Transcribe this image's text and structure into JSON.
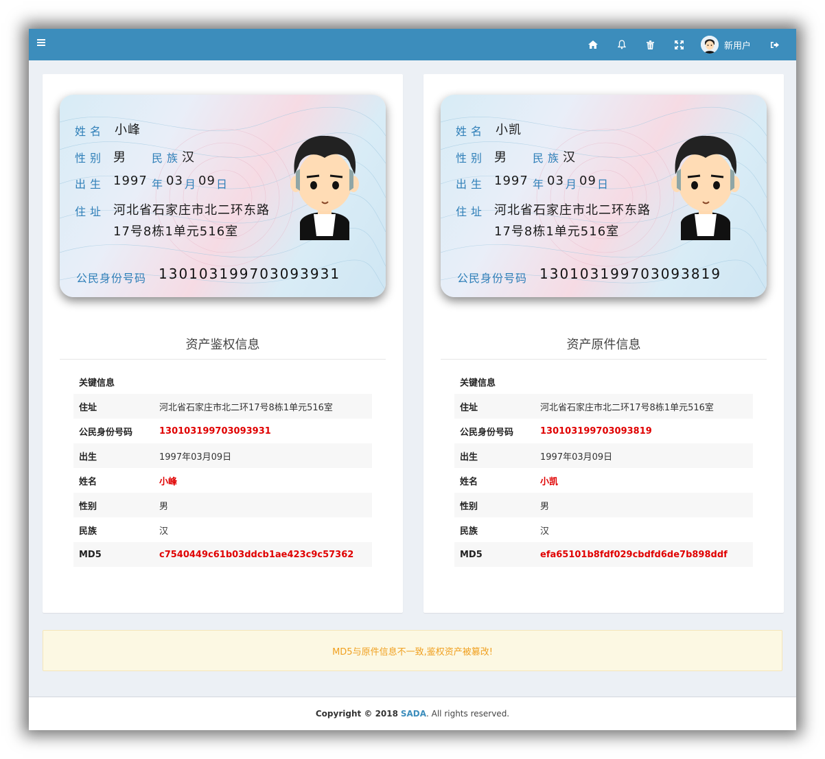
{
  "topbar": {
    "user_name": "新用户",
    "icons": [
      "menu-icon",
      "home-icon",
      "bell-icon",
      "trash-icon",
      "fullscreen-icon",
      "logout-icon"
    ]
  },
  "left": {
    "card": {
      "label_name": "姓名",
      "label_gender": "性别",
      "label_ethnic": "民族",
      "label_birth": "出生",
      "label_year_unit": "年",
      "label_month_unit": "月",
      "label_day_unit": "日",
      "label_address": "住址",
      "label_id": "公民身份号码",
      "name": "小峰",
      "gender": "男",
      "ethnic": "汉",
      "birth_year": "1997",
      "birth_month": "03",
      "birth_day": "09",
      "address_line1": "河北省石家庄市北二环东路",
      "address_line2": "17号8栋1单元516室",
      "id_number": "130103199703093931"
    },
    "section_title": "资产鉴权信息",
    "table": {
      "header": "关键信息",
      "rows": [
        {
          "key": "住址",
          "value": "河北省石家庄市北二环17号8栋1单元516室"
        },
        {
          "key": "公民身份号码",
          "value": "130103199703093931"
        },
        {
          "key": "出生",
          "value": "1997年03月09日"
        },
        {
          "key": "姓名",
          "value": "小峰"
        },
        {
          "key": "性别",
          "value": "男"
        },
        {
          "key": "民族",
          "value": "汉"
        },
        {
          "key": "MD5",
          "value": "c7540449c61b03ddcb1ae423c9c57362"
        }
      ]
    }
  },
  "right": {
    "card": {
      "label_name": "姓名",
      "label_gender": "性别",
      "label_ethnic": "民族",
      "label_birth": "出生",
      "label_year_unit": "年",
      "label_month_unit": "月",
      "label_day_unit": "日",
      "label_address": "住址",
      "label_id": "公民身份号码",
      "name": "小凯",
      "gender": "男",
      "ethnic": "汉",
      "birth_year": "1997",
      "birth_month": "03",
      "birth_day": "09",
      "address_line1": "河北省石家庄市北二环东路",
      "address_line2": "17号8栋1单元516室",
      "id_number": "130103199703093819"
    },
    "section_title": "资产原件信息",
    "table": {
      "header": "关键信息",
      "rows": [
        {
          "key": "住址",
          "value": "河北省石家庄市北二环17号8栋1单元516室"
        },
        {
          "key": "公民身份号码",
          "value": "130103199703093819"
        },
        {
          "key": "出生",
          "value": "1997年03月09日"
        },
        {
          "key": "姓名",
          "value": "小凯"
        },
        {
          "key": "性别",
          "value": "男"
        },
        {
          "key": "民族",
          "value": "汉"
        },
        {
          "key": "MD5",
          "value": "efa65101b8fdf029cbdfd6de7b898ddf"
        }
      ]
    }
  },
  "alert": {
    "message": "MD5与原件信息不一致,鉴权资产被篡改!"
  },
  "footer": {
    "copyright": "Copyright © 2018",
    "brand": "SADA",
    "suffix": ". All rights reserved."
  },
  "colors": {
    "topbar": "#3c8dbc",
    "background": "#ecf0f5",
    "highlight_red": "#e00000",
    "alert_text": "#f0a020",
    "alert_bg": "#fcf8e3",
    "card_label": "#2f7fb8"
  }
}
